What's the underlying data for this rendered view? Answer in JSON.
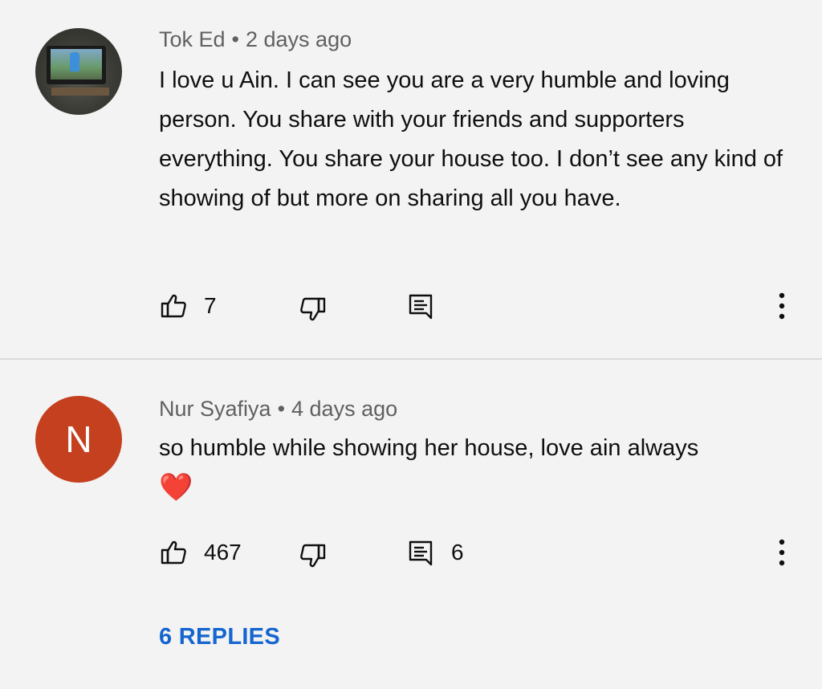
{
  "comments": [
    {
      "author": "Tok Ed",
      "separator": "•",
      "time": "2 days ago",
      "text": "I love u Ain. I can see you are a very humble and loving person. You share with your friends and supporters everything. You share your house too. I don’t see any kind of showing of but more on sharing all you have.",
      "likes": "7",
      "avatar": "photo"
    },
    {
      "author": "Nur Syafiya",
      "separator": "•",
      "time": "4 days ago",
      "text": "so humble while showing her house, love ain always",
      "emoji": "❤️",
      "likes": "467",
      "replies_count": "6",
      "avatar_letter": "N",
      "avatar_color": "#c4401e",
      "replies_link": "6 REPLIES"
    }
  ],
  "icons": {
    "like": "thumbs-up-icon",
    "dislike": "thumbs-down-icon",
    "reply": "reply-comment-icon",
    "more": "more-vertical-icon"
  },
  "colors": {
    "background": "#f3f3f3",
    "link": "#1565d0",
    "meta": "#606060"
  }
}
